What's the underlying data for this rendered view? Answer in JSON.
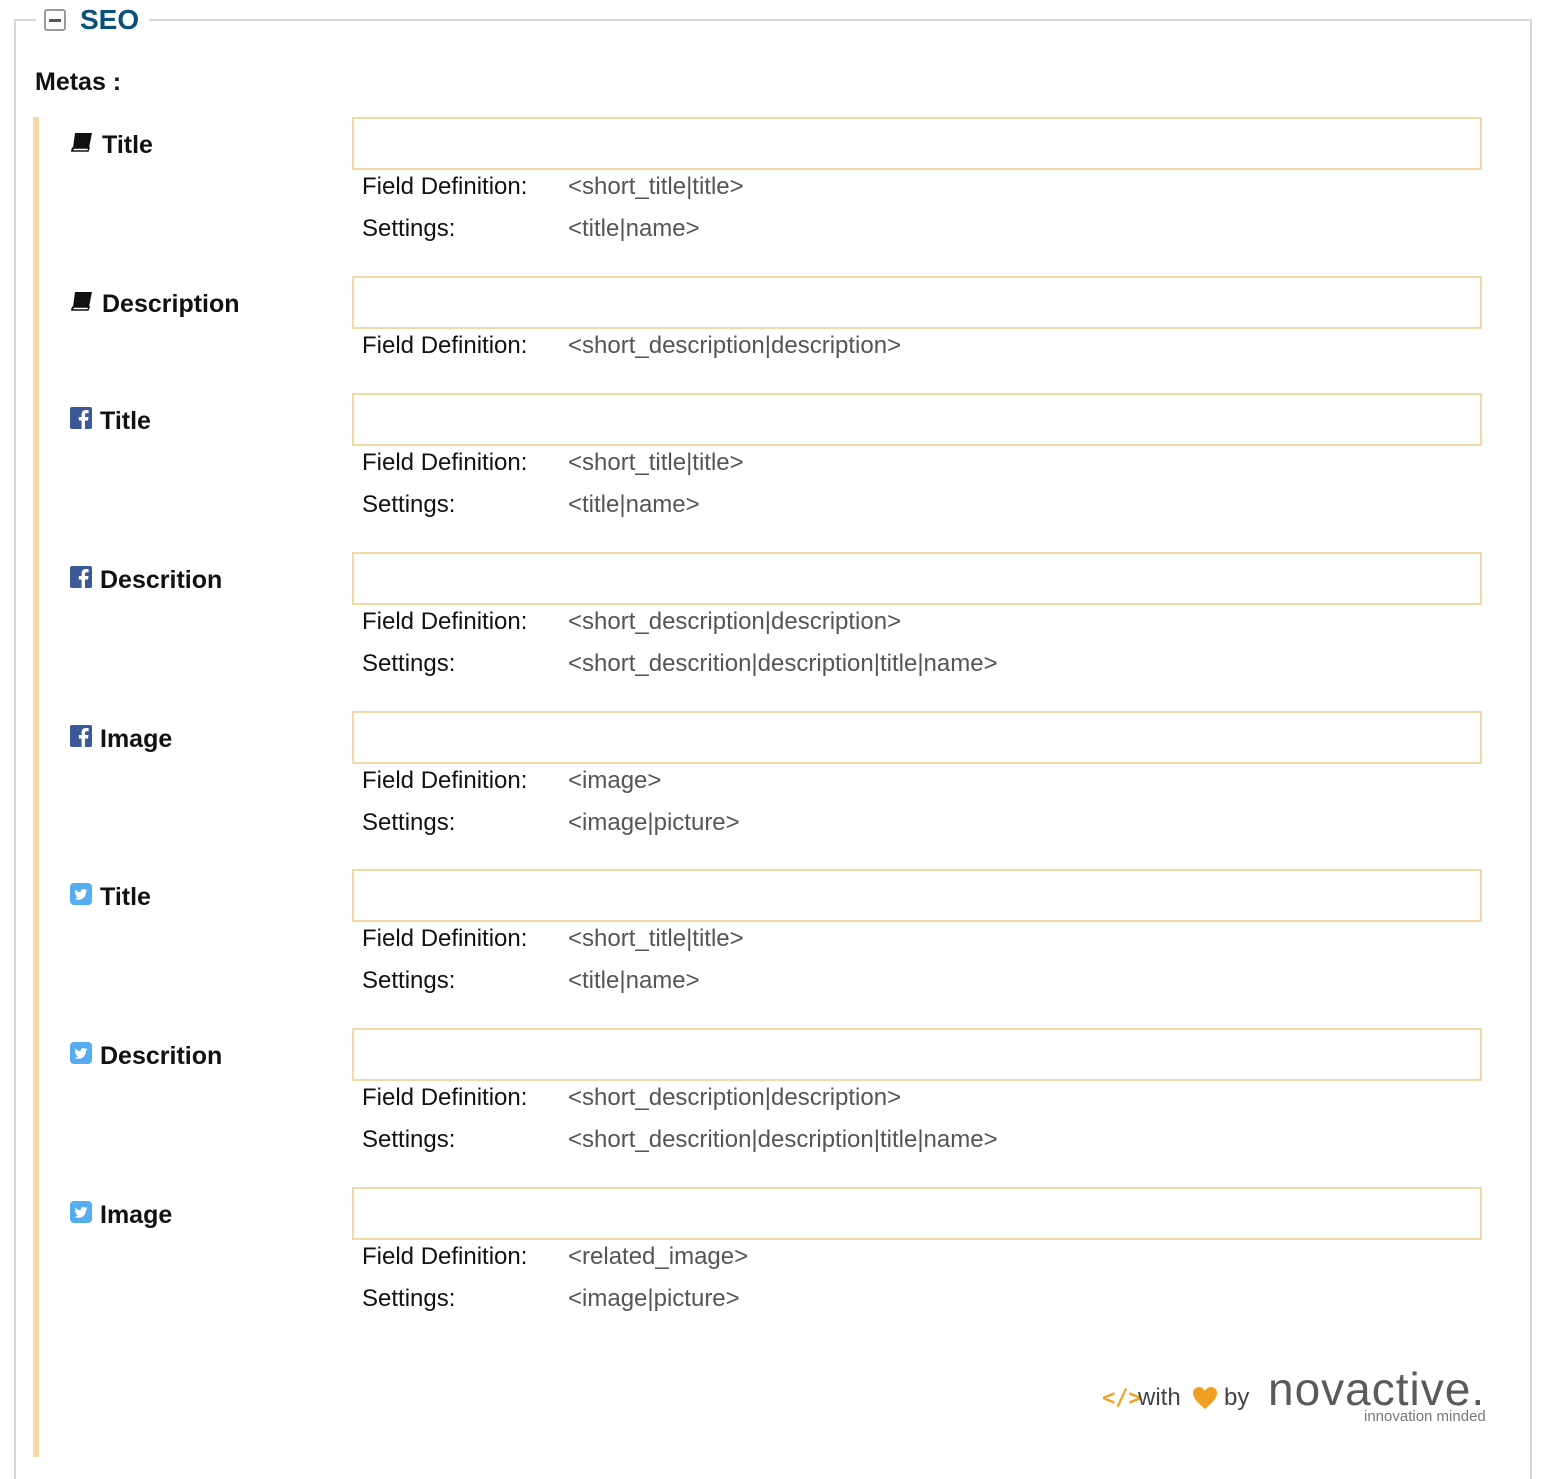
{
  "section": {
    "title": "SEO"
  },
  "metas_label": "Metas :",
  "rows": [
    {
      "label": "Title",
      "icon": "book-icon",
      "input_value": "",
      "field_definition_label": "Field Definition:",
      "field_definition": "<short_title|title>",
      "settings_label": "Settings:",
      "settings": "<title|name>"
    },
    {
      "label": "Description",
      "icon": "book-icon",
      "input_value": "",
      "field_definition_label": "Field Definition:",
      "field_definition": "<short_description|description>"
    },
    {
      "label": "Title",
      "icon": "facebook-icon",
      "input_value": "",
      "field_definition_label": "Field Definition:",
      "field_definition": "<short_title|title>",
      "settings_label": "Settings:",
      "settings": "<title|name>"
    },
    {
      "label": "Descrition",
      "icon": "facebook-icon",
      "input_value": "",
      "field_definition_label": "Field Definition:",
      "field_definition": "<short_description|description>",
      "settings_label": "Settings:",
      "settings": "<short_descrition|description|title|name>"
    },
    {
      "label": "Image",
      "icon": "facebook-icon",
      "input_value": "",
      "field_definition_label": "Field Definition:",
      "field_definition": "<image>",
      "settings_label": "Settings:",
      "settings": "<image|picture>"
    },
    {
      "label": "Title",
      "icon": "twitter-icon",
      "input_value": "",
      "field_definition_label": "Field Definition:",
      "field_definition": "<short_title|title>",
      "settings_label": "Settings:",
      "settings": "<title|name>"
    },
    {
      "label": "Descrition",
      "icon": "twitter-icon",
      "input_value": "",
      "field_definition_label": "Field Definition:",
      "field_definition": "<short_description|description>",
      "settings_label": "Settings:",
      "settings": "<short_descrition|description|title|name>"
    },
    {
      "label": "Image",
      "icon": "twitter-icon",
      "input_value": "",
      "field_definition_label": "Field Definition:",
      "field_definition": "<related_image>",
      "settings_label": "Settings:",
      "settings": "<image|picture>"
    }
  ],
  "footer": {
    "code_symbol": "</>",
    "with": "with",
    "by": "by",
    "brand": "novactive.",
    "tagline": "innovation minded"
  },
  "colors": {
    "section_title": "#0b4f7c",
    "input_border": "#f3d9a6",
    "rail": "#f4d9a4",
    "facebook": "#3b5998",
    "twitter": "#55acee",
    "accent_orange": "#f0a020"
  }
}
